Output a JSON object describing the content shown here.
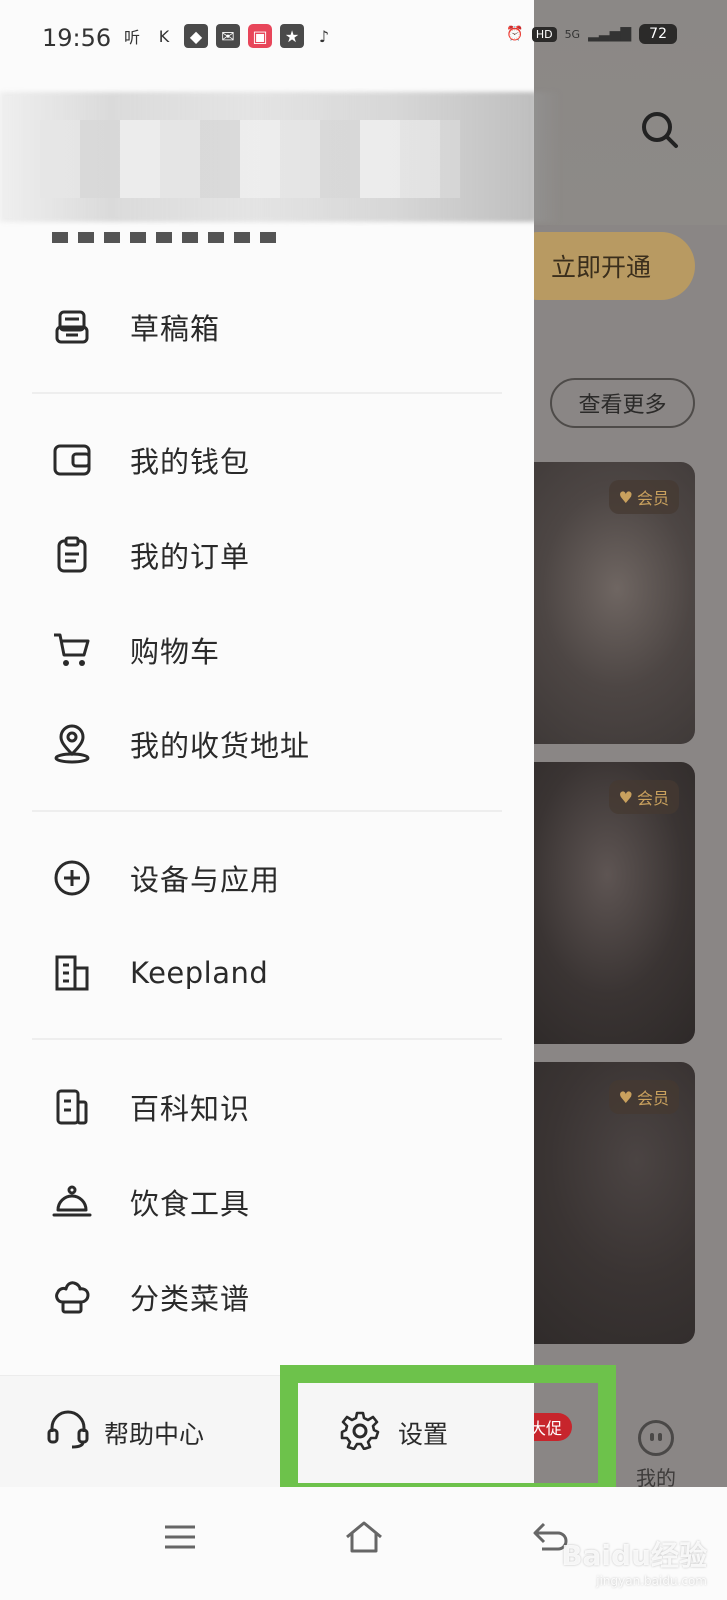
{
  "status_bar": {
    "time": "19:56",
    "battery": "72",
    "network": "5G",
    "hd": "HD",
    "app_icons": [
      "听",
      "K"
    ]
  },
  "background": {
    "vip_button": "立即开通",
    "more_button": "查看更多",
    "member_badge": "会员",
    "promo_badge": "大促",
    "my_tab": "我的"
  },
  "drawer": {
    "items": [
      {
        "label": "草稿箱",
        "icon": "drafts-icon"
      },
      {
        "label": "我的钱包",
        "icon": "wallet-icon"
      },
      {
        "label": "我的订单",
        "icon": "order-icon"
      },
      {
        "label": "购物车",
        "icon": "cart-icon"
      },
      {
        "label": "我的收货地址",
        "icon": "location-icon"
      },
      {
        "label": "设备与应用",
        "icon": "plus-circle-icon"
      },
      {
        "label": "Keepland",
        "icon": "building-icon"
      },
      {
        "label": "百科知识",
        "icon": "encyclopedia-icon"
      },
      {
        "label": "饮食工具",
        "icon": "dining-icon"
      },
      {
        "label": "分类菜谱",
        "icon": "chef-hat-icon"
      }
    ],
    "help_label": "帮助中心",
    "settings_label": "设置"
  },
  "watermark": {
    "brand": "Baidu经验",
    "url": "jingyan.baidu.com"
  },
  "colors": {
    "highlight": "#6dc24b",
    "vip_gold": "#b89a62",
    "promo_red": "#c7252c"
  }
}
